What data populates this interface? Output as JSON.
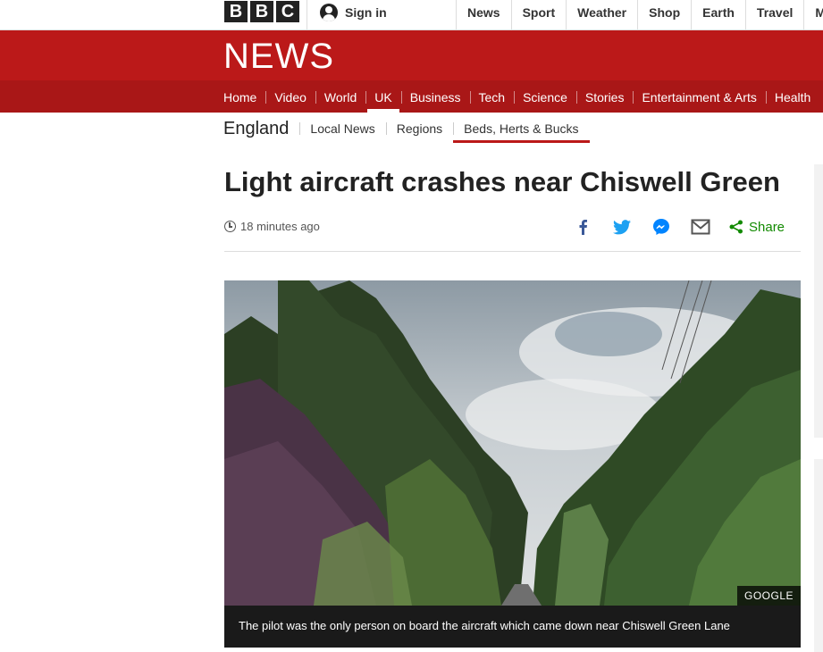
{
  "brand": {
    "logo_letters": [
      "B",
      "B",
      "C"
    ],
    "section_title": "NEWS",
    "colors": {
      "primary_red": "#bb1919",
      "nav_red": "#a91717",
      "share_green": "#128a00",
      "facebook": "#3b5998",
      "twitter": "#1da1f2",
      "messenger": "#0084ff"
    }
  },
  "topbar": {
    "sign_in_label": "Sign in",
    "sign_in_icon": "user-icon",
    "nav": [
      "News",
      "Sport",
      "Weather",
      "Shop",
      "Earth",
      "Travel",
      "More"
    ]
  },
  "section_nav": {
    "items": [
      "Home",
      "Video",
      "World",
      "UK",
      "Business",
      "Tech",
      "Science",
      "Stories",
      "Entertainment & Arts",
      "Health"
    ],
    "active": "UK"
  },
  "sub_nav": {
    "region": "England",
    "items": [
      "Local News",
      "Regions",
      "Beds, Herts & Bucks"
    ],
    "active": "Beds, Herts & Bucks"
  },
  "article": {
    "headline": "Light aircraft crashes near Chiswell Green",
    "timestamp": "18 minutes ago",
    "share_label": "Share",
    "share_icons": [
      "facebook-icon",
      "twitter-icon",
      "messenger-icon",
      "email-icon",
      "share-icon"
    ],
    "image_credit": "GOOGLE",
    "image_caption": "The pilot was the only person on board the aircraft which came down near Chiswell Green Lane"
  }
}
